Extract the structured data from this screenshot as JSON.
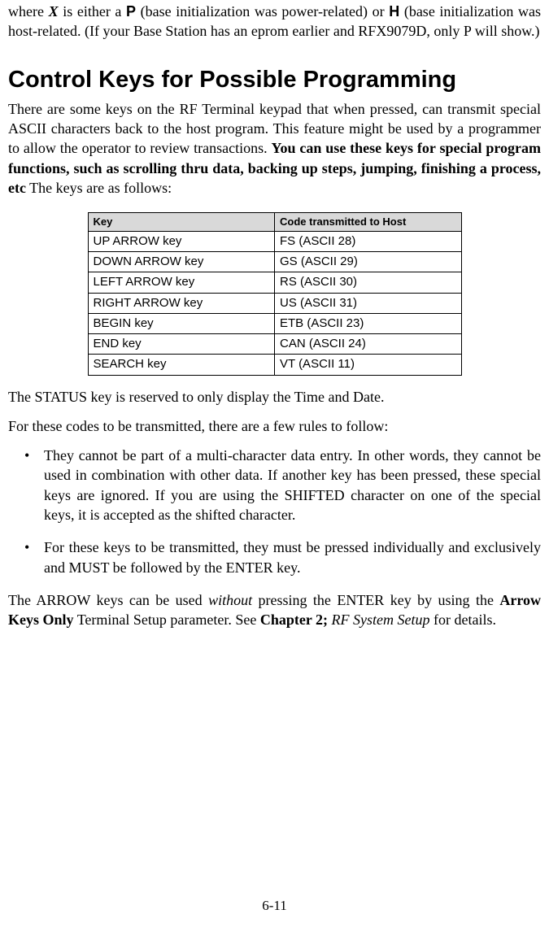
{
  "intro": {
    "prefix": "where ",
    "x": "X",
    "mid1": " is either a ",
    "p": "P",
    "mid2": " (base initialization was power-related) or ",
    "h": "H",
    "suffix": " (base initialization was host-related. (If your Base Station has an eprom earlier and RFX9079D, only P will show.)"
  },
  "heading": "Control Keys for Possible Programming",
  "para1": {
    "a": "There are some keys on the RF Terminal keypad that when pressed, can transmit special ASCII characters back to the host program. This feature might be used by a programmer to allow the operator to review transactions. ",
    "bold": "You can use these keys for special program functions, such as scrolling thru data, backing up steps, jumping, finishing a process, etc",
    "b": " The keys are as follows:"
  },
  "table": {
    "headers": {
      "key": "Key",
      "code": "Code transmitted to Host"
    },
    "rows": [
      {
        "key": "UP ARROW key",
        "code": "FS (ASCII 28)"
      },
      {
        "key": "DOWN ARROW key",
        "code": "GS (ASCII 29)"
      },
      {
        "key": "LEFT ARROW key",
        "code": "RS (ASCII 30)"
      },
      {
        "key": "RIGHT ARROW key",
        "code": "US (ASCII 31)"
      },
      {
        "key": "BEGIN key",
        "code": "ETB (ASCII 23)"
      },
      {
        "key": "END key",
        "code": "CAN (ASCII 24)"
      },
      {
        "key": "SEARCH key",
        "code": "VT (ASCII 11)"
      }
    ]
  },
  "para2": "The STATUS key is reserved to only display the Time and Date.",
  "para3": "For these codes to be transmitted, there are a few rules to follow:",
  "bullets": [
    "They cannot be part of a multi-character data entry.  In other words, they cannot be used in combination with other data. If another key has been pressed, these special keys are ignored. If you are using the SHIFTED character on one of the special keys, it is accepted as the shifted character.",
    "For these keys to be transmitted, they must be pressed individually and exclusively and MUST be followed by the ENTER key."
  ],
  "para4": {
    "a": "The ARROW keys can be used ",
    "without": "without",
    "b": " pressing the ENTER key by using the ",
    "arrow": "Arrow Keys Only",
    "c": " Terminal Setup parameter. See ",
    "chapter": "Chapter 2;",
    "d": " ",
    "rf": "RF System Setup",
    "e": " for details."
  },
  "page_number": "6-11"
}
